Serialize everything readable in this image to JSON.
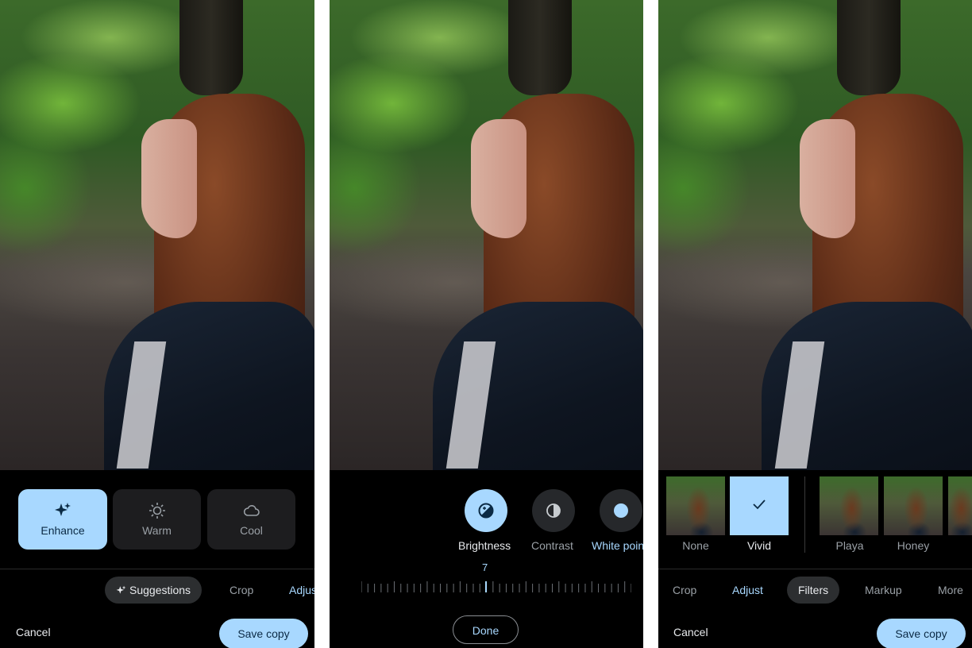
{
  "colors": {
    "accent": "#a8d8ff",
    "background": "#000000",
    "muted_text": "#9aa0a6"
  },
  "panel1": {
    "suggestions": [
      {
        "label": "Enhance",
        "icon": "sparkle-icon",
        "selected": true
      },
      {
        "label": "Warm",
        "icon": "sun-icon",
        "selected": false
      },
      {
        "label": "Cool",
        "icon": "cloud-icon",
        "selected": false
      }
    ],
    "tabs": [
      {
        "label": "Suggestions",
        "icon": "sparkle-icon",
        "state": "pill"
      },
      {
        "label": "Crop",
        "state": "normal"
      },
      {
        "label": "Adjust",
        "state": "active"
      }
    ],
    "cancel_label": "Cancel",
    "save_label": "Save copy"
  },
  "panel2": {
    "tools": [
      {
        "label": "Brightness",
        "icon": "brightness-icon",
        "selected": true
      },
      {
        "label": "Contrast",
        "icon": "contrast-icon",
        "selected": false
      },
      {
        "label": "White point",
        "icon": "white-point-icon",
        "selected": false
      }
    ],
    "slider_value": "7",
    "done_label": "Done"
  },
  "panel3": {
    "filters": [
      {
        "label": "None",
        "selected": false
      },
      {
        "label": "Vivid",
        "selected": true
      },
      {
        "label": "Playa",
        "selected": false
      },
      {
        "label": "Honey",
        "selected": false
      }
    ],
    "tabs": [
      {
        "label": "Crop",
        "state": "normal"
      },
      {
        "label": "Adjust",
        "state": "active"
      },
      {
        "label": "Filters",
        "state": "pill"
      },
      {
        "label": "Markup",
        "state": "normal"
      },
      {
        "label": "More",
        "state": "normal"
      }
    ],
    "cancel_label": "Cancel",
    "save_label": "Save copy"
  }
}
